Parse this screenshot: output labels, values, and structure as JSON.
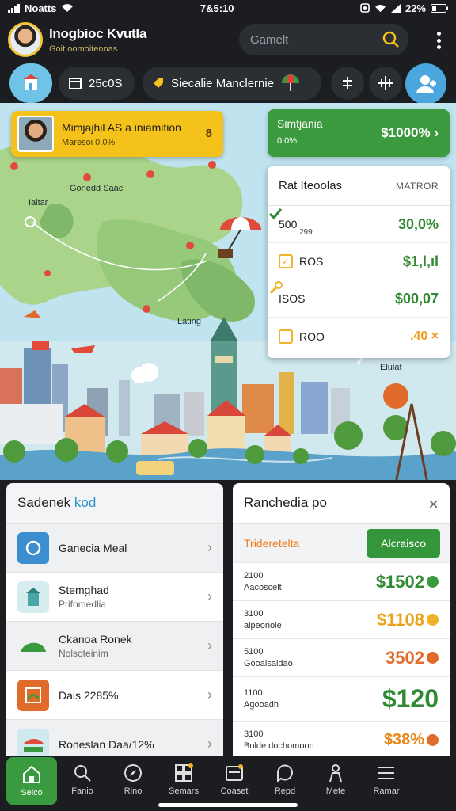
{
  "status_bar": {
    "carrier": "Noatts",
    "time": "7&5:10",
    "battery": "22%"
  },
  "header": {
    "user_name": "Inogbioc Kvutla",
    "user_subtitle": "Goit oomoitennas",
    "search_placeholder": "Gamelt"
  },
  "toolbar": {
    "count_label": "25c0S",
    "title_label": "Siecalie Manclernie"
  },
  "map": {
    "labels": [
      "Gonedd Saac",
      "Ialtar",
      "Lating",
      "Elulat"
    ],
    "profile_card": {
      "title": "Mimjajhil AS a iniamition",
      "subtitle": "Maresoi 0.0%",
      "value": "8"
    },
    "green_card": {
      "title": "Simtjania",
      "subtitle": "0.0%",
      "price": "$1000%",
      "arrow": "›"
    },
    "stats_card": {
      "title": "Rat Iteoolas",
      "subtitle": "MATROR",
      "rows": [
        {
          "label": "500",
          "sub": "299",
          "value": "30,0%",
          "value_color": "#2f8a33",
          "icon": "check"
        },
        {
          "label": "ROS",
          "value": "$1,l,ıl",
          "value_color": "#2f8a33",
          "icon": "check-box"
        },
        {
          "label": "ISOS",
          "value": "$00,07",
          "value_color": "#2f8a33",
          "icon": "wrench"
        },
        {
          "label": "ROO",
          "value": ".40 ×",
          "value_color": "#ef9a1a",
          "icon": "box"
        }
      ]
    }
  },
  "left_panel": {
    "title_prefix": "Sadenek",
    "title_accent": "kod",
    "items": [
      {
        "title": "Ganecia Meal",
        "sub": ""
      },
      {
        "title": "Stemghad",
        "sub": "Prifomedlia"
      },
      {
        "title": "Ckanoa Ronek",
        "sub": "Nolsoteinim"
      },
      {
        "title": "Dais 2285%",
        "sub": ""
      },
      {
        "title": "Roneslan Daa/12%",
        "sub": ""
      }
    ]
  },
  "right_panel": {
    "title": "Ranchedia po",
    "close": "×",
    "tab_label": "Trideretelta",
    "button_label": "Alcraisco",
    "rows": [
      {
        "a": "2100",
        "b": "Aacoscelt",
        "price": "$1502",
        "color": "#2f8a33",
        "dot": "#3a9a3f",
        "size": 22
      },
      {
        "a": "3100",
        "b": "aipeonole",
        "price": "$1108",
        "color": "#e8a21a",
        "dot": "#f0b32a",
        "size": 22
      },
      {
        "a": "5100",
        "b": "Gooalsaldao",
        "price": "3502",
        "color": "#e06b2a",
        "dot": "#e06b2a",
        "size": 22
      },
      {
        "a": "1100",
        "b": "Agooadh",
        "price": "$120",
        "color": "#2f8a33",
        "dot": "",
        "size": 32
      },
      {
        "a": "3100",
        "b": "Bolde dochomoon",
        "price": "$38%",
        "color": "#e8871a",
        "dot": "#e06b2a",
        "size": 20
      }
    ]
  },
  "nav": [
    {
      "label": "Selco",
      "icon": "home-icon"
    },
    {
      "label": "Fanio",
      "icon": "search-icon"
    },
    {
      "label": "Rino",
      "icon": "compass-icon"
    },
    {
      "label": "Semars",
      "icon": "grid-icon"
    },
    {
      "label": "Coaset",
      "icon": "card-icon"
    },
    {
      "label": "Repd",
      "icon": "chat-icon"
    },
    {
      "label": "Mete",
      "icon": "person-icon"
    },
    {
      "label": "Ramar",
      "icon": "menu-icon"
    }
  ]
}
